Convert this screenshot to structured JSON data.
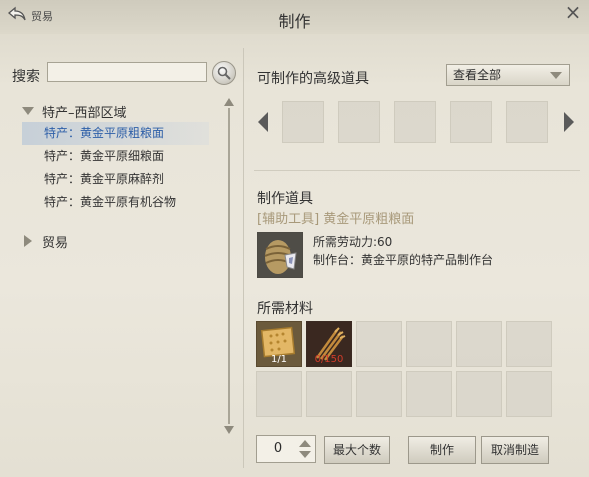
{
  "window": {
    "back_label": "贸易",
    "title": "制作",
    "close_symbol": "×"
  },
  "search": {
    "label": "搜索",
    "value": "",
    "placeholder": ""
  },
  "tree": {
    "category1": "特产–西部区域",
    "leaves": [
      {
        "prefix": "特产：",
        "name": "黄金平原粗粮面",
        "selected": true
      },
      {
        "prefix": "特产：",
        "name": "黄金平原细粮面",
        "selected": false
      },
      {
        "prefix": "特产：",
        "name": "黄金平原麻醉剂",
        "selected": false
      },
      {
        "prefix": "特产：",
        "name": "黄金平原有机谷物",
        "selected": false
      }
    ],
    "category2": "贸易"
  },
  "advanced": {
    "title": "可制作的高级道具",
    "filter_value": "查看全部"
  },
  "crafting": {
    "title": "制作道具",
    "item_category": "[辅助工具] 黄金平原粗粮面",
    "labor_label": "所需劳动力:",
    "labor_value": "60",
    "station_label": "制作台：",
    "station_value": "黄金平原的特产品制作台"
  },
  "materials": {
    "title": "所需材料",
    "items": [
      {
        "icon": "grain-sheet-icon",
        "count": "1/1"
      },
      {
        "icon": "wheat-bundle-icon",
        "count": "0/150"
      }
    ]
  },
  "footer": {
    "quantity": "0",
    "max_label": "最大个数",
    "craft_label": "制作",
    "cancel_label": "取消制造"
  },
  "colors": {
    "selected_text": "#2d5fa8",
    "category_text": "#a8997a",
    "missing_count": "#d23c2a"
  }
}
